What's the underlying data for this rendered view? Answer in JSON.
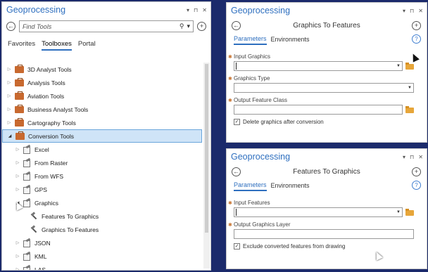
{
  "left_pane": {
    "title": "Geoprocessing",
    "controls": [
      "▾",
      "⊓",
      "✕"
    ],
    "back_icon": "back-arrow-icon",
    "search_placeholder": "Find Tools",
    "search_icon": "⚲",
    "search_dd": "▾",
    "add_icon": "plus-circle-icon",
    "tabs": [
      {
        "label": "Favorites",
        "active": false
      },
      {
        "label": "Toolboxes",
        "active": true
      },
      {
        "label": "Portal",
        "active": false
      }
    ],
    "tree": [
      {
        "label": "3D Analyst Tools",
        "kind": "toolbox",
        "level": 0,
        "expanded": false
      },
      {
        "label": "Analysis Tools",
        "kind": "toolbox",
        "level": 0,
        "expanded": false
      },
      {
        "label": "Aviation Tools",
        "kind": "toolbox",
        "level": 0,
        "expanded": false
      },
      {
        "label": "Business Analyst Tools",
        "kind": "toolbox",
        "level": 0,
        "expanded": false
      },
      {
        "label": "Cartography Tools",
        "kind": "toolbox",
        "level": 0,
        "expanded": false
      },
      {
        "label": "Conversion Tools",
        "kind": "toolbox",
        "level": 0,
        "expanded": true,
        "selected": true
      },
      {
        "label": "Excel",
        "kind": "toolset",
        "level": 1,
        "expanded": false
      },
      {
        "label": "From Raster",
        "kind": "toolset",
        "level": 1,
        "expanded": false
      },
      {
        "label": "From WFS",
        "kind": "toolset",
        "level": 1,
        "expanded": false
      },
      {
        "label": "GPS",
        "kind": "toolset",
        "level": 1,
        "expanded": false
      },
      {
        "label": "Graphics",
        "kind": "toolset",
        "level": 1,
        "expanded": true
      },
      {
        "label": "Features To Graphics",
        "kind": "tool",
        "level": 2
      },
      {
        "label": "Graphics To Features",
        "kind": "tool",
        "level": 2
      },
      {
        "label": "JSON",
        "kind": "toolset",
        "level": 1,
        "expanded": false
      },
      {
        "label": "KML",
        "kind": "toolset",
        "level": 1,
        "expanded": false
      },
      {
        "label": "LAS",
        "kind": "toolset",
        "level": 1,
        "expanded": false
      }
    ]
  },
  "tool_top": {
    "title": "Geoprocessing",
    "controls": [
      "▾",
      "⊓",
      "✕"
    ],
    "tool_name": "Graphics To Features",
    "tabs": [
      {
        "label": "Parameters",
        "active": true
      },
      {
        "label": "Environments",
        "active": false
      }
    ],
    "help": "?",
    "params": [
      {
        "label": "Input Graphics",
        "required": true,
        "dropdown": true,
        "folder": true,
        "value": ""
      },
      {
        "label": "Graphics Type",
        "required": true,
        "dropdown": true,
        "folder": false,
        "value": ""
      },
      {
        "label": "Output Feature Class",
        "required": true,
        "dropdown": false,
        "folder": true,
        "value": ""
      }
    ],
    "checkbox": {
      "label": "Delete graphics after conversion",
      "checked": true
    }
  },
  "tool_bottom": {
    "title": "Geoprocessing",
    "controls": [
      "▾",
      "⊓",
      "✕"
    ],
    "tool_name": "Features To Graphics",
    "tabs": [
      {
        "label": "Parameters",
        "active": true
      },
      {
        "label": "Environments",
        "active": false
      }
    ],
    "help": "?",
    "params": [
      {
        "label": "Input Features",
        "required": true,
        "dropdown": true,
        "folder": true,
        "value": ""
      },
      {
        "label": "Output Graphics Layer",
        "required": true,
        "dropdown": false,
        "folder": false,
        "value": ""
      }
    ],
    "checkbox": {
      "label": "Exclude converted features from drawing",
      "checked": true
    }
  },
  "colors": {
    "accent": "#2e6fbf",
    "selection": "#cfe4f7",
    "toolbox": "#c8692f",
    "required": "#c7722e",
    "background": "#1b2a6b"
  }
}
